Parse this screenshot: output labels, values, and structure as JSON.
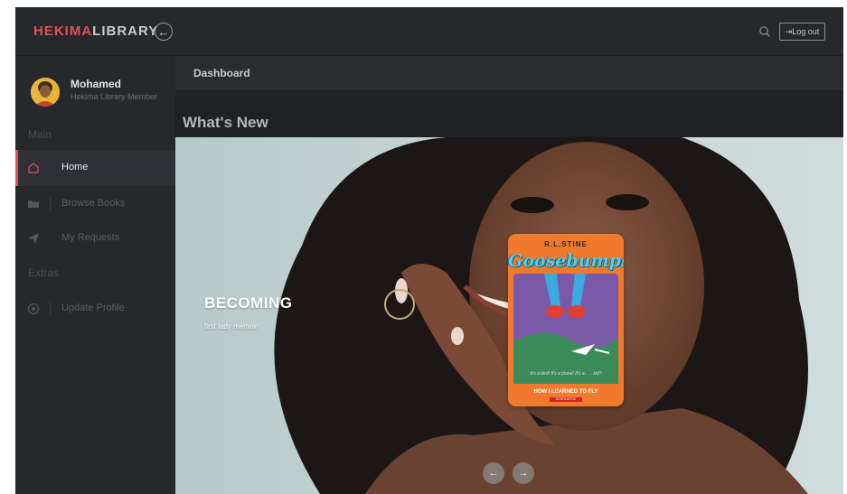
{
  "brand": {
    "part1": "HEKIMA",
    "part2": "LIBRARY"
  },
  "topbar": {
    "collapse_icon": "arrow-left",
    "search_icon": "search-icon",
    "logout_label": "Log out",
    "logout_icon": "logout-icon"
  },
  "user": {
    "name": "Mohamed",
    "role": "Hekima Library Member"
  },
  "sidebar": {
    "sections": [
      "Main",
      "Extras"
    ],
    "items": [
      {
        "label": "Home",
        "icon": "home-icon",
        "active": true
      },
      {
        "label": "Browse Books",
        "icon": "folder-icon",
        "active": false
      },
      {
        "label": "My Requests",
        "icon": "send-icon",
        "active": false
      },
      {
        "label": "Update Profile",
        "icon": "target-icon",
        "active": false
      }
    ]
  },
  "main": {
    "header_title": "Dashboard",
    "section_title": "What's New"
  },
  "hero": {
    "title": "BECOMING",
    "subtitle": "first lady memoir",
    "prev_icon": "arrow-left",
    "next_icon": "arrow-right"
  },
  "book": {
    "author": "R.L.STINE",
    "series": "Goosebumps",
    "tagline": "It's a bird! It's a plane! It's a . . . kid?",
    "subtitle": "HOW I LEARNED TO FLY",
    "publisher": "SCHOLASTIC"
  },
  "colors": {
    "accent": "#e0505b",
    "background": "#1f2125",
    "sidebar": "#26282c",
    "book_cover": "#ef7a2e"
  }
}
